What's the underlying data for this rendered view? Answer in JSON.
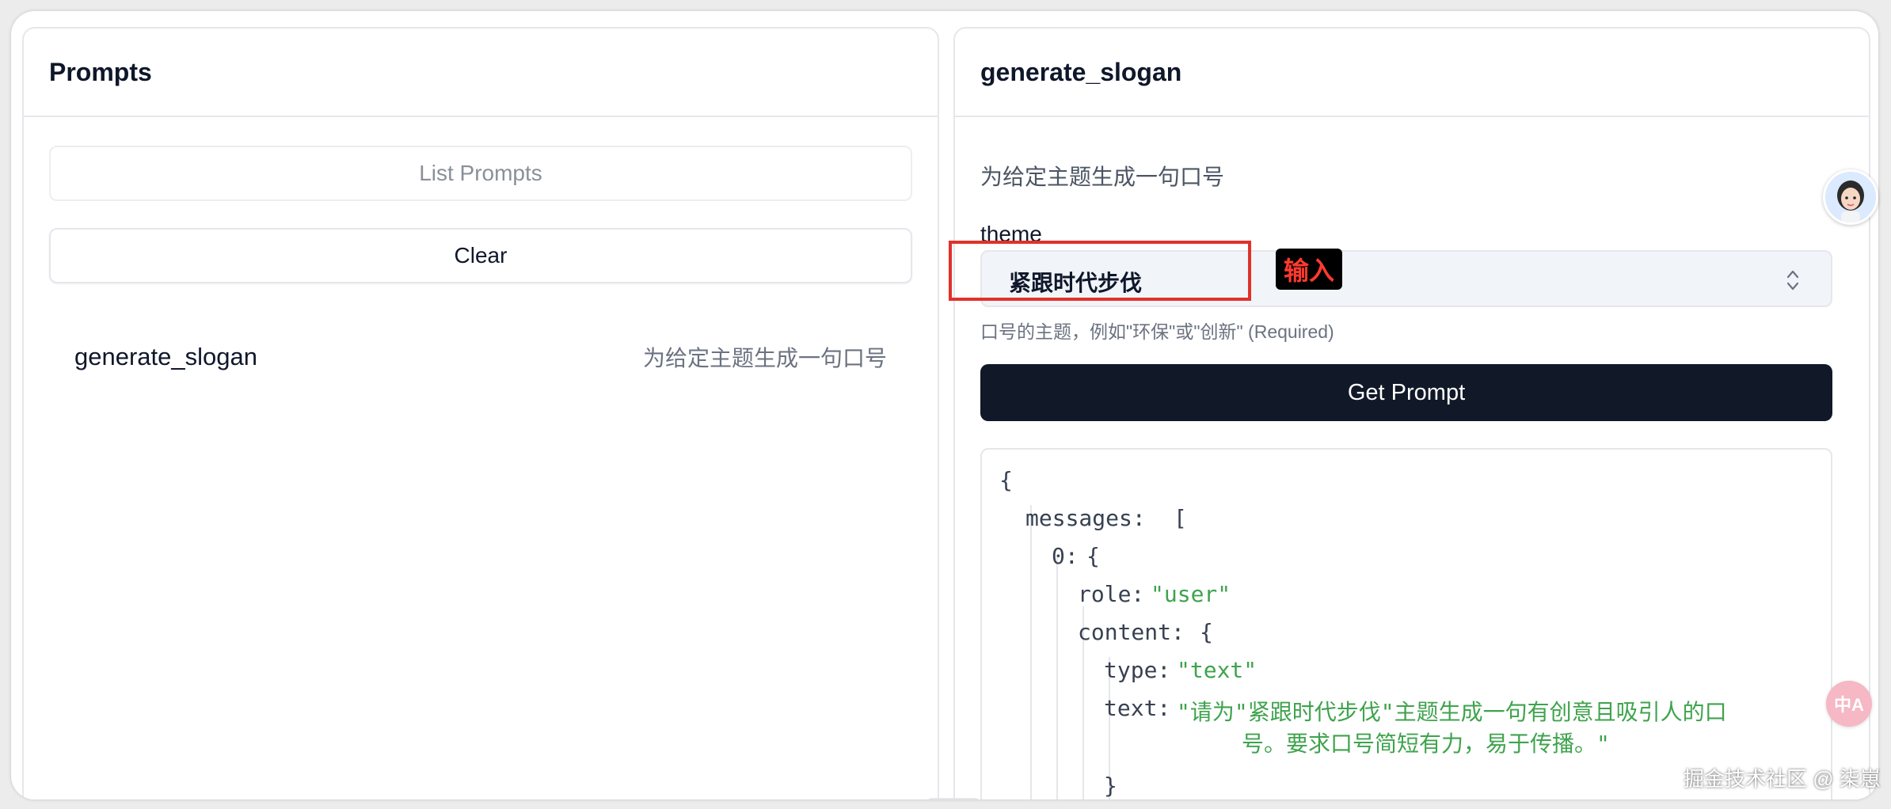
{
  "left_panel": {
    "title": "Prompts",
    "list_button": "List Prompts",
    "clear_button": "Clear",
    "items": [
      {
        "name": "generate_slogan",
        "description": "为给定主题生成一句口号"
      }
    ]
  },
  "right_panel": {
    "title": "generate_slogan",
    "description": "为给定主题生成一句口号",
    "argument": {
      "label": "theme",
      "value": "紧跟时代步伐",
      "hint": "口号的主题，例如\"环保\"或\"创新\" (Required)"
    },
    "annotation_badge": "输入",
    "get_button": "Get Prompt",
    "result": {
      "open_brace": "{",
      "messages_key": "messages:",
      "open_bracket": "[",
      "index_key": "0:",
      "index_open": "{",
      "role_key": "role:",
      "role_value": "\"user\"",
      "content_key": "content:",
      "content_open": "{",
      "type_key": "type:",
      "type_value": "\"text\"",
      "text_key": "text:",
      "text_line1": "\"请为\"紧跟时代步伐\"主题生成一句有创意且吸引人的口",
      "text_line2": "号。要求口号简短有力，易于传播。\"",
      "content_close": "}"
    }
  },
  "side_widgets": {
    "translate_label": "中A"
  },
  "watermark": "掘金技术社区 @ 柒崽",
  "colors": {
    "primary": "#111827",
    "string": "#3fa34d",
    "highlight": "#e0322a"
  }
}
